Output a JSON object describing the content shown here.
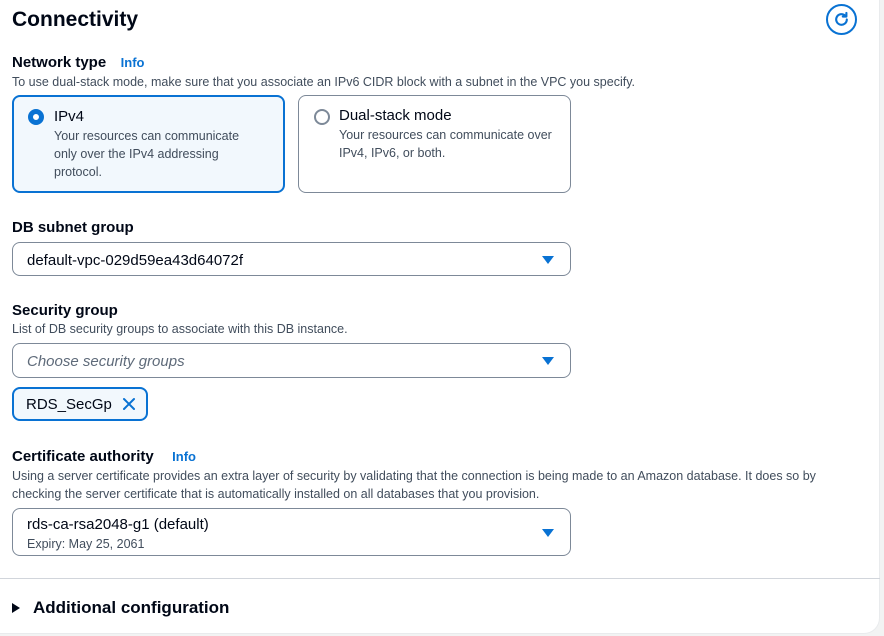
{
  "section": {
    "title": "Connectivity",
    "refresh_icon": "refresh-icon"
  },
  "network_type": {
    "label": "Network type",
    "info": "Info",
    "description": "To use dual-stack mode, make sure that you associate an IPv6 CIDR block with a subnet in the VPC you specify.",
    "options": [
      {
        "title": "IPv4",
        "description": "Your resources can communicate only over the IPv4 addressing protocol.",
        "selected": true
      },
      {
        "title": "Dual-stack mode",
        "description": "Your resources can communicate over IPv4, IPv6, or both.",
        "selected": false
      }
    ]
  },
  "db_subnet_group": {
    "label": "DB subnet group",
    "value": "default-vpc-029d59ea43d64072f"
  },
  "security_group": {
    "label": "Security group",
    "description": "List of DB security groups to associate with this DB instance.",
    "placeholder": "Choose security groups",
    "tokens": [
      {
        "label": "RDS_SecGp"
      }
    ]
  },
  "certificate_authority": {
    "label": "Certificate authority",
    "info": "Info",
    "description": "Using a server certificate provides an extra layer of security by validating that the connection is being made to an Amazon database. It does so by checking the server certificate that is automatically installed on all databases that you provision.",
    "value": "rds-ca-rsa2048-g1 (default)",
    "secondary": "Expiry: May 25, 2061"
  },
  "additional_configuration": {
    "label": "Additional configuration"
  },
  "colors": {
    "accent": "#0972d3",
    "text": "#000716",
    "secondary_text": "#414d5c"
  }
}
